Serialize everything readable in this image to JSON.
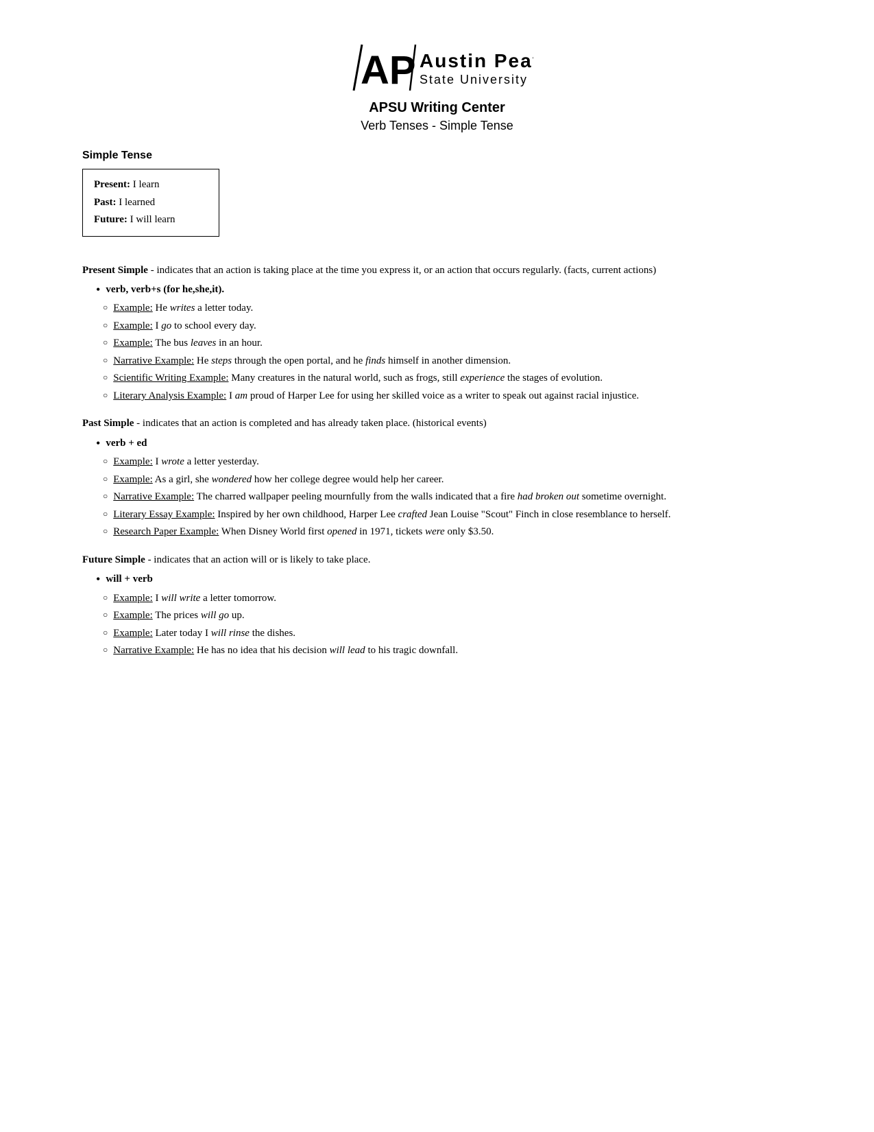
{
  "header": {
    "logo_ap": "AP",
    "logo_austin": "Austin",
    "logo_peay": "Peay",
    "logo_state_university": "State University",
    "title": "APSU Writing Center",
    "subtitle": "Verb Tenses - Simple Tense"
  },
  "simple_tense_box": {
    "heading": "Simple Tense",
    "present_label": "Present:",
    "present_value": " I learn",
    "past_label": "Past:",
    "past_value": " I learned",
    "future_label": "Future:",
    "future_value": " I will learn"
  },
  "present_simple": {
    "intro": "Present Simple - indicates that an action is taking place at the time you express it, or an action that occurs regularly. (facts, current actions)",
    "rule": "verb, verb+s (for he,she,it).",
    "examples": [
      {
        "label": "Example:",
        "text": " He ",
        "italic": "writes",
        "rest": " a letter today."
      },
      {
        "label": "Example:",
        "text": " I ",
        "italic": "go",
        "rest": " to school every day."
      },
      {
        "label": "Example:",
        "text": " The bus ",
        "italic": "leaves",
        "rest": " in an hour."
      },
      {
        "label": "Narrative Example:",
        "text": " He ",
        "italic": "steps",
        "rest": " through the open portal, and he ",
        "italic2": "finds",
        "rest2": " himself in another dimension."
      },
      {
        "label": "Scientific Writing Example:",
        "text": " Many creatures in the natural world, such as frogs, still ",
        "italic": "experience",
        "rest": " the stages of evolution."
      },
      {
        "label": "Literary Analysis Example:",
        "text": " I ",
        "italic": "am",
        "rest": " proud of Harper Lee for using her skilled voice as a writer to speak out against racial injustice."
      }
    ]
  },
  "past_simple": {
    "intro": "Past Simple - indicates that an action is completed and has already taken place. (historical events)",
    "rule": "verb + ed",
    "examples": [
      {
        "label": "Example:",
        "text": " I ",
        "italic": "wrote",
        "rest": " a letter yesterday."
      },
      {
        "label": "Example:",
        "text": " As a girl, she ",
        "italic": "wondered",
        "rest": " how her college degree would help her career."
      },
      {
        "label": "Narrative Example:",
        "text": " The charred wallpaper peeling mournfully from the walls indicated that a fire ",
        "italic": "had broken out",
        "rest": " sometime overnight."
      },
      {
        "label": "Literary Essay Example:",
        "text": " Inspired by her own childhood, Harper Lee ",
        "italic": "crafted",
        "rest": " Jean Louise \"Scout\" Finch in close resemblance to herself."
      },
      {
        "label": "Research Paper Example:",
        "text": " When Disney World first ",
        "italic": "opened",
        "rest": " in 1971, tickets ",
        "italic2": "were",
        "rest2": " only $3.50."
      }
    ]
  },
  "future_simple": {
    "intro": "Future Simple - indicates that an action will or is likely to take place.",
    "rule": "will + verb",
    "examples": [
      {
        "label": "Example:",
        "text": " I ",
        "italic": "will write",
        "rest": " a letter tomorrow."
      },
      {
        "label": "Example:",
        "text": " The prices ",
        "italic": "will go",
        "rest": " up."
      },
      {
        "label": "Example:",
        "text": " Later today I ",
        "italic": "will rinse",
        "rest": " the dishes."
      },
      {
        "label": "Narrative Example:",
        "text": " He has no idea that his decision ",
        "italic": "will lead",
        "rest": " to his tragic downfall."
      }
    ]
  }
}
